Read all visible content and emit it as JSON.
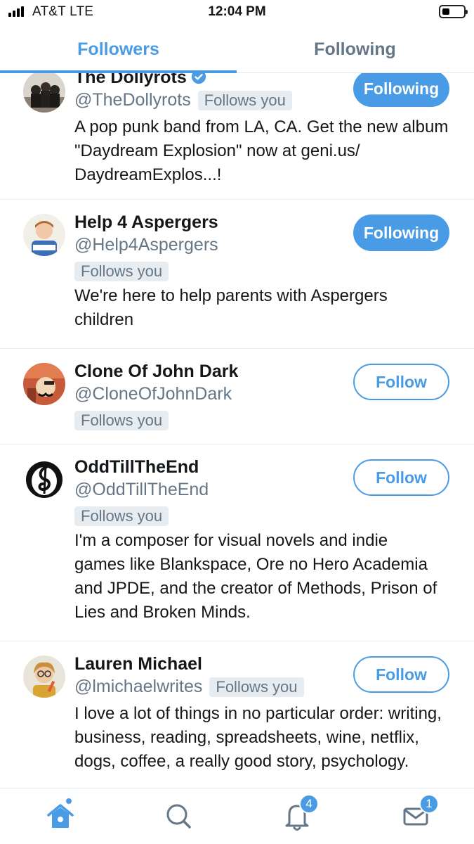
{
  "status_bar": {
    "carrier": "AT&T  LTE",
    "time": "12:04 PM"
  },
  "tabs": [
    {
      "label": "Followers",
      "active": true
    },
    {
      "label": "Following",
      "active": false
    }
  ],
  "users": [
    {
      "name": "The Dollyrots",
      "handle": "@TheDollyrots",
      "follows_you": "Follows you",
      "verified": true,
      "button": "Following",
      "bio": "A pop punk band from LA, CA. Get the new album \"Daydream Explosion\" now at geni.us/ DaydreamExplos...!"
    },
    {
      "name": "Help 4 Aspergers",
      "handle": "@Help4Aspergers",
      "follows_you": "Follows you",
      "button": "Following",
      "bio": "We're here to help parents with Aspergers children"
    },
    {
      "name": "Clone Of John Dark",
      "handle": "@CloneOfJohnDark",
      "follows_you": "Follows you",
      "button": "Follow",
      "bio": ""
    },
    {
      "name": "OddTillTheEnd",
      "handle": "@OddTillTheEnd",
      "follows_you": "Follows you",
      "button": "Follow",
      "bio": "I'm a composer for visual novels and indie games like Blankspace, Ore no Hero Academia and JPDE, and the creator of Methods, Prison of Lies and Broken Minds."
    },
    {
      "name": "Lauren Michael",
      "handle": "@lmichaelwrites",
      "follows_you": "Follows you",
      "button": "Follow",
      "bio": "I love a lot of things in no particular order: writing, business, reading, spreadsheets, wine, netflix, dogs, coffee, a really good story, psychology."
    }
  ],
  "bottom_nav": {
    "notifications_count": "4",
    "messages_count": "1",
    "items": [
      "home-icon",
      "search-icon",
      "notifications-icon",
      "messages-icon"
    ]
  },
  "colors": {
    "accent": "#4a9be6",
    "secondary_text": "#657786",
    "badge_bg": "#e6ecf0"
  }
}
